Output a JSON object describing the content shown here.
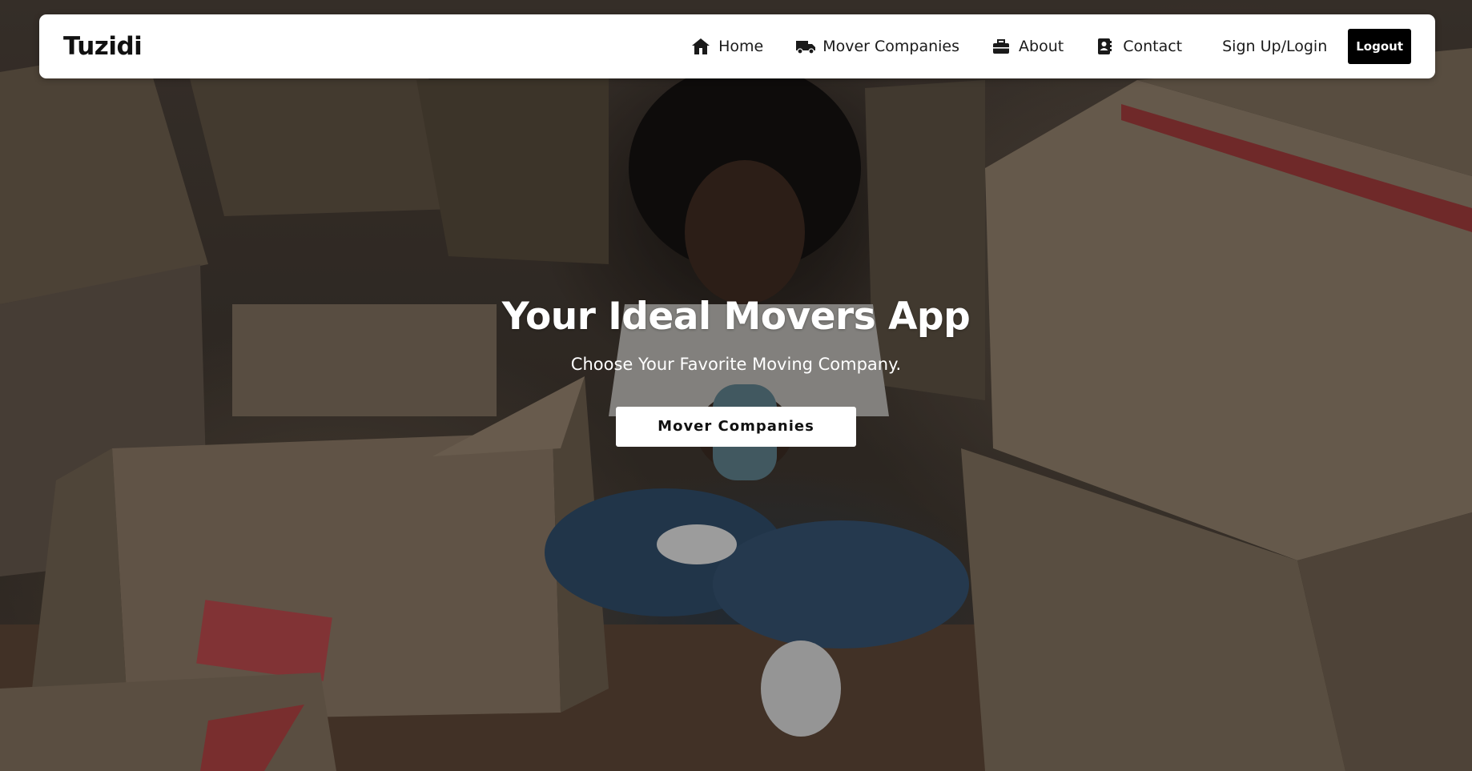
{
  "navbar": {
    "brand": "Tuzidi",
    "items": [
      {
        "label": "Home",
        "icon": "house-icon"
      },
      {
        "label": "Mover Companies",
        "icon": "truck-icon"
      },
      {
        "label": "About",
        "icon": "briefcase-icon"
      },
      {
        "label": "Contact",
        "icon": "address-book-icon"
      }
    ],
    "signup_label": "Sign Up/Login",
    "logout_label": "Logout"
  },
  "hero": {
    "title": "Your Ideal Movers App",
    "subtitle": "Choose Your Favorite Moving Company.",
    "cta_label": "Mover Companies",
    "background": "photo-woman-sitting-among-moving-boxes"
  },
  "colors": {
    "navbar_bg": "#ffffff",
    "logout_bg": "#000000",
    "hero_text": "#ffffff",
    "cta_bg": "#ffffff"
  }
}
